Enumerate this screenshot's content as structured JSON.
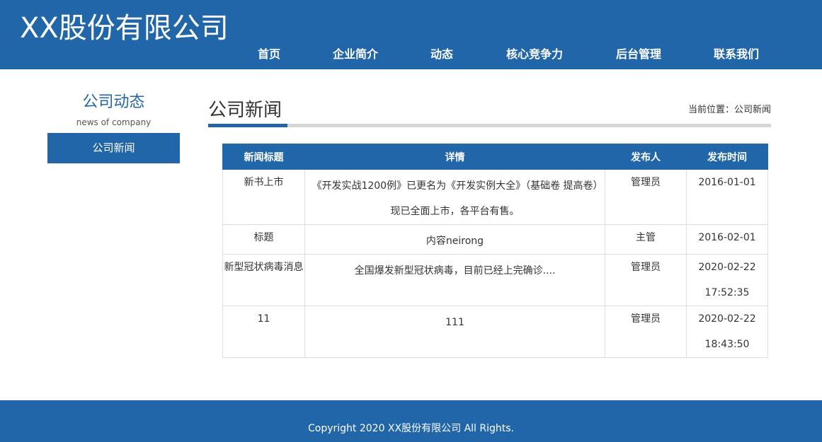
{
  "header": {
    "logo": "XX股份有限公司",
    "nav": [
      "首页",
      "企业简介",
      "动态",
      "核心竞争力",
      "后台管理",
      "联系我们"
    ]
  },
  "sidebar": {
    "title": "公司动态",
    "subtitle": "news of company",
    "items": [
      {
        "label": "公司新闻"
      }
    ]
  },
  "main": {
    "title": "公司新闻",
    "breadcrumb": "当前位置：公司新闻",
    "table": {
      "headers": [
        "新闻标题",
        "详情",
        "发布人",
        "发布时间"
      ],
      "rows": [
        {
          "title": "新书上市",
          "detail": "《开发实战1200例》已更名为《开发实例大全》（基础卷 提高卷）现已全面上市，各平台有售。",
          "author": "管理员",
          "time": "2016-01-01"
        },
        {
          "title": "标题",
          "detail": "内容neirong",
          "author": "主管",
          "time": "2016-02-01"
        },
        {
          "title": "新型冠状病毒消息",
          "detail": "全国爆发新型冠状病毒，目前已经上完确诊....",
          "author": "管理员",
          "time": "2020-02-22 17:52:35"
        },
        {
          "title": "11",
          "detail": "111",
          "author": "管理员",
          "time": "2020-02-22 18:43:50"
        }
      ]
    }
  },
  "footer": {
    "copyright": "Copyright 2020 XX股份有限公司 All Rights."
  },
  "colors": {
    "brand": "#2266aa",
    "divider": "#d6d6d6"
  }
}
